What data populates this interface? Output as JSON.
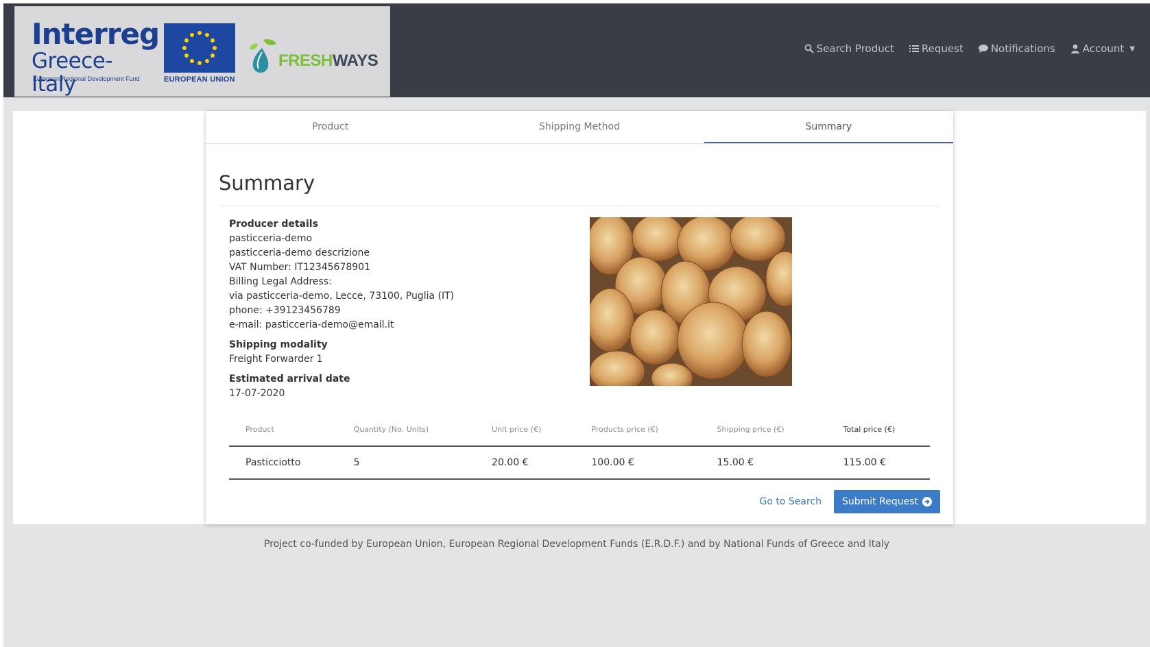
{
  "header": {
    "logos": {
      "interreg_word": "Interreg",
      "interreg_sub": "Greece-Italy",
      "interreg_fund": "European Regional Development Fund",
      "eu_label": "EUROPEAN UNION",
      "fresh": "FRESH",
      "ways": "WAYS"
    },
    "nav": [
      {
        "label": "Search Product",
        "icon": "search-icon"
      },
      {
        "label": "Request",
        "icon": "list-icon"
      },
      {
        "label": "Notifications",
        "icon": "comment-icon"
      },
      {
        "label": "Account",
        "icon": "user-icon"
      }
    ]
  },
  "tabs": [
    {
      "label": "Product"
    },
    {
      "label": "Shipping Method"
    },
    {
      "label": "Summary",
      "active": true
    }
  ],
  "summary": {
    "title": "Summary",
    "producer_label": "Producer details",
    "producer_lines": [
      "pasticceria-demo",
      "pasticceria-demo descrizione",
      "VAT Number: IT12345678901",
      "Billing Legal Address:",
      "via pasticceria-demo, Lecce, 73100, Puglia (IT)",
      "phone: +39123456789",
      "e-mail: pasticceria-demo@email.it"
    ],
    "shipping_label": "Shipping modality",
    "shipping_value": "Freight Forwarder 1",
    "arrival_label": "Estimated arrival date",
    "arrival_value": "17-07-2020"
  },
  "table": {
    "headers": [
      "Product",
      "Quantity (No. Units)",
      "Unit price (€)",
      "Products price (€)",
      "Shipping price (€)",
      "Total price (€)"
    ],
    "rows": [
      [
        "Pasticciotto",
        "5",
        "20.00 €",
        "100.00 €",
        "15.00 €",
        "115.00 €"
      ]
    ]
  },
  "actions": {
    "go_to_search": "Go to Search",
    "submit": "Submit Request"
  },
  "footer": {
    "text": "Project co-funded by European Union, European Regional Development Funds (E.R.D.F.) and by National Funds of Greece and Italy"
  },
  "colors": {
    "header_bg": "#3a3d45",
    "accent": "#3b7bc7",
    "tab_active": "#4b5fa8"
  }
}
